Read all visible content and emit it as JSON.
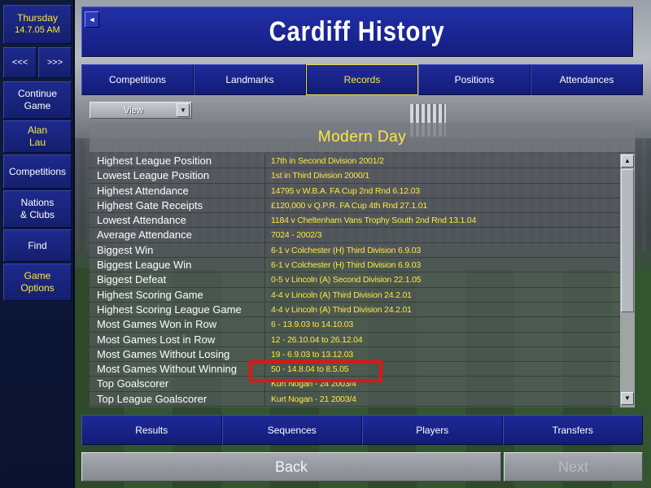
{
  "window": {
    "title": "Cardiff History"
  },
  "sidebar": {
    "date_day": "Thursday",
    "date_value": "14.7.05 AM",
    "back_label": "<<<",
    "forward_label": ">>>",
    "continue_line1": "Continue",
    "continue_line2": "Game",
    "manager_line1": "Alan",
    "manager_line2": "Lau",
    "competitions_label": "Competitions",
    "nations_line1": "Nations",
    "nations_line2": "& Clubs",
    "find_label": "Find",
    "options_line1": "Game",
    "options_line2": "Options"
  },
  "corner_button_label": "◄",
  "tabs": [
    "Competitions",
    "Landmarks",
    "Records",
    "Positions",
    "Attendances"
  ],
  "active_tab": "Records",
  "view_dropdown": {
    "label": "View",
    "arrow_icon": "chevron-down-icon"
  },
  "panel": {
    "heading": "Modern Day"
  },
  "records": [
    {
      "label": "Highest League Position",
      "value": "17th in Second Division 2001/2"
    },
    {
      "label": "Lowest League Position",
      "value": "1st in Third Division 2000/1"
    },
    {
      "label": "Highest Attendance",
      "value": "14795 v W.B.A. FA Cup 2nd Rnd 6.12.03"
    },
    {
      "label": "Highest Gate Receipts",
      "value": "£120,000 v Q.P.R. FA Cup 4th Rnd 27.1.01"
    },
    {
      "label": "Lowest Attendance",
      "value": "1184 v Cheltenham Vans Trophy South 2nd Rnd 13.1.04"
    },
    {
      "label": "Average Attendance",
      "value": "7024 - 2002/3"
    },
    {
      "label": "Biggest Win",
      "value": "6-1 v Colchester (H) Third Division 6.9.03"
    },
    {
      "label": "Biggest League Win",
      "value": "6-1 v Colchester (H) Third Division 6.9.03"
    },
    {
      "label": "Biggest Defeat",
      "value": "0-5 v Lincoln (A) Second Division 22.1.05"
    },
    {
      "label": "Highest Scoring Game",
      "value": "4-4 v Lincoln (A) Third Division 24.2.01"
    },
    {
      "label": "Highest Scoring League Game",
      "value": "4-4 v Lincoln (A) Third Division 24.2.01"
    },
    {
      "label": "Most Games Won in Row",
      "value": "6 - 13.9.03 to 14.10.03"
    },
    {
      "label": "Most Games Lost in Row",
      "value": "12 - 26.10.04 to 26.12.04"
    },
    {
      "label": "Most Games Without Losing",
      "value": "19 - 6.9.03 to 13.12.03"
    },
    {
      "label": "Most Games Without Winning",
      "value": "50 - 14.8.04 to 8.5.05"
    },
    {
      "label": "Top Goalscorer",
      "value": "Kurt Nogan - 24 2003/4"
    },
    {
      "label": "Top League Goalscorer",
      "value": "Kurt Nogan - 21 2003/4"
    }
  ],
  "scrollbar": {
    "up_icon": "▲",
    "down_icon": "▼"
  },
  "bottom_tabs": [
    "Results",
    "Sequences",
    "Players",
    "Transfers"
  ],
  "footer": {
    "back_label": "Back",
    "next_label": "Next"
  },
  "colors": {
    "accent_yellow": "#ffe840",
    "panel_blue": "#141e80",
    "highlight_red": "#e41414"
  }
}
